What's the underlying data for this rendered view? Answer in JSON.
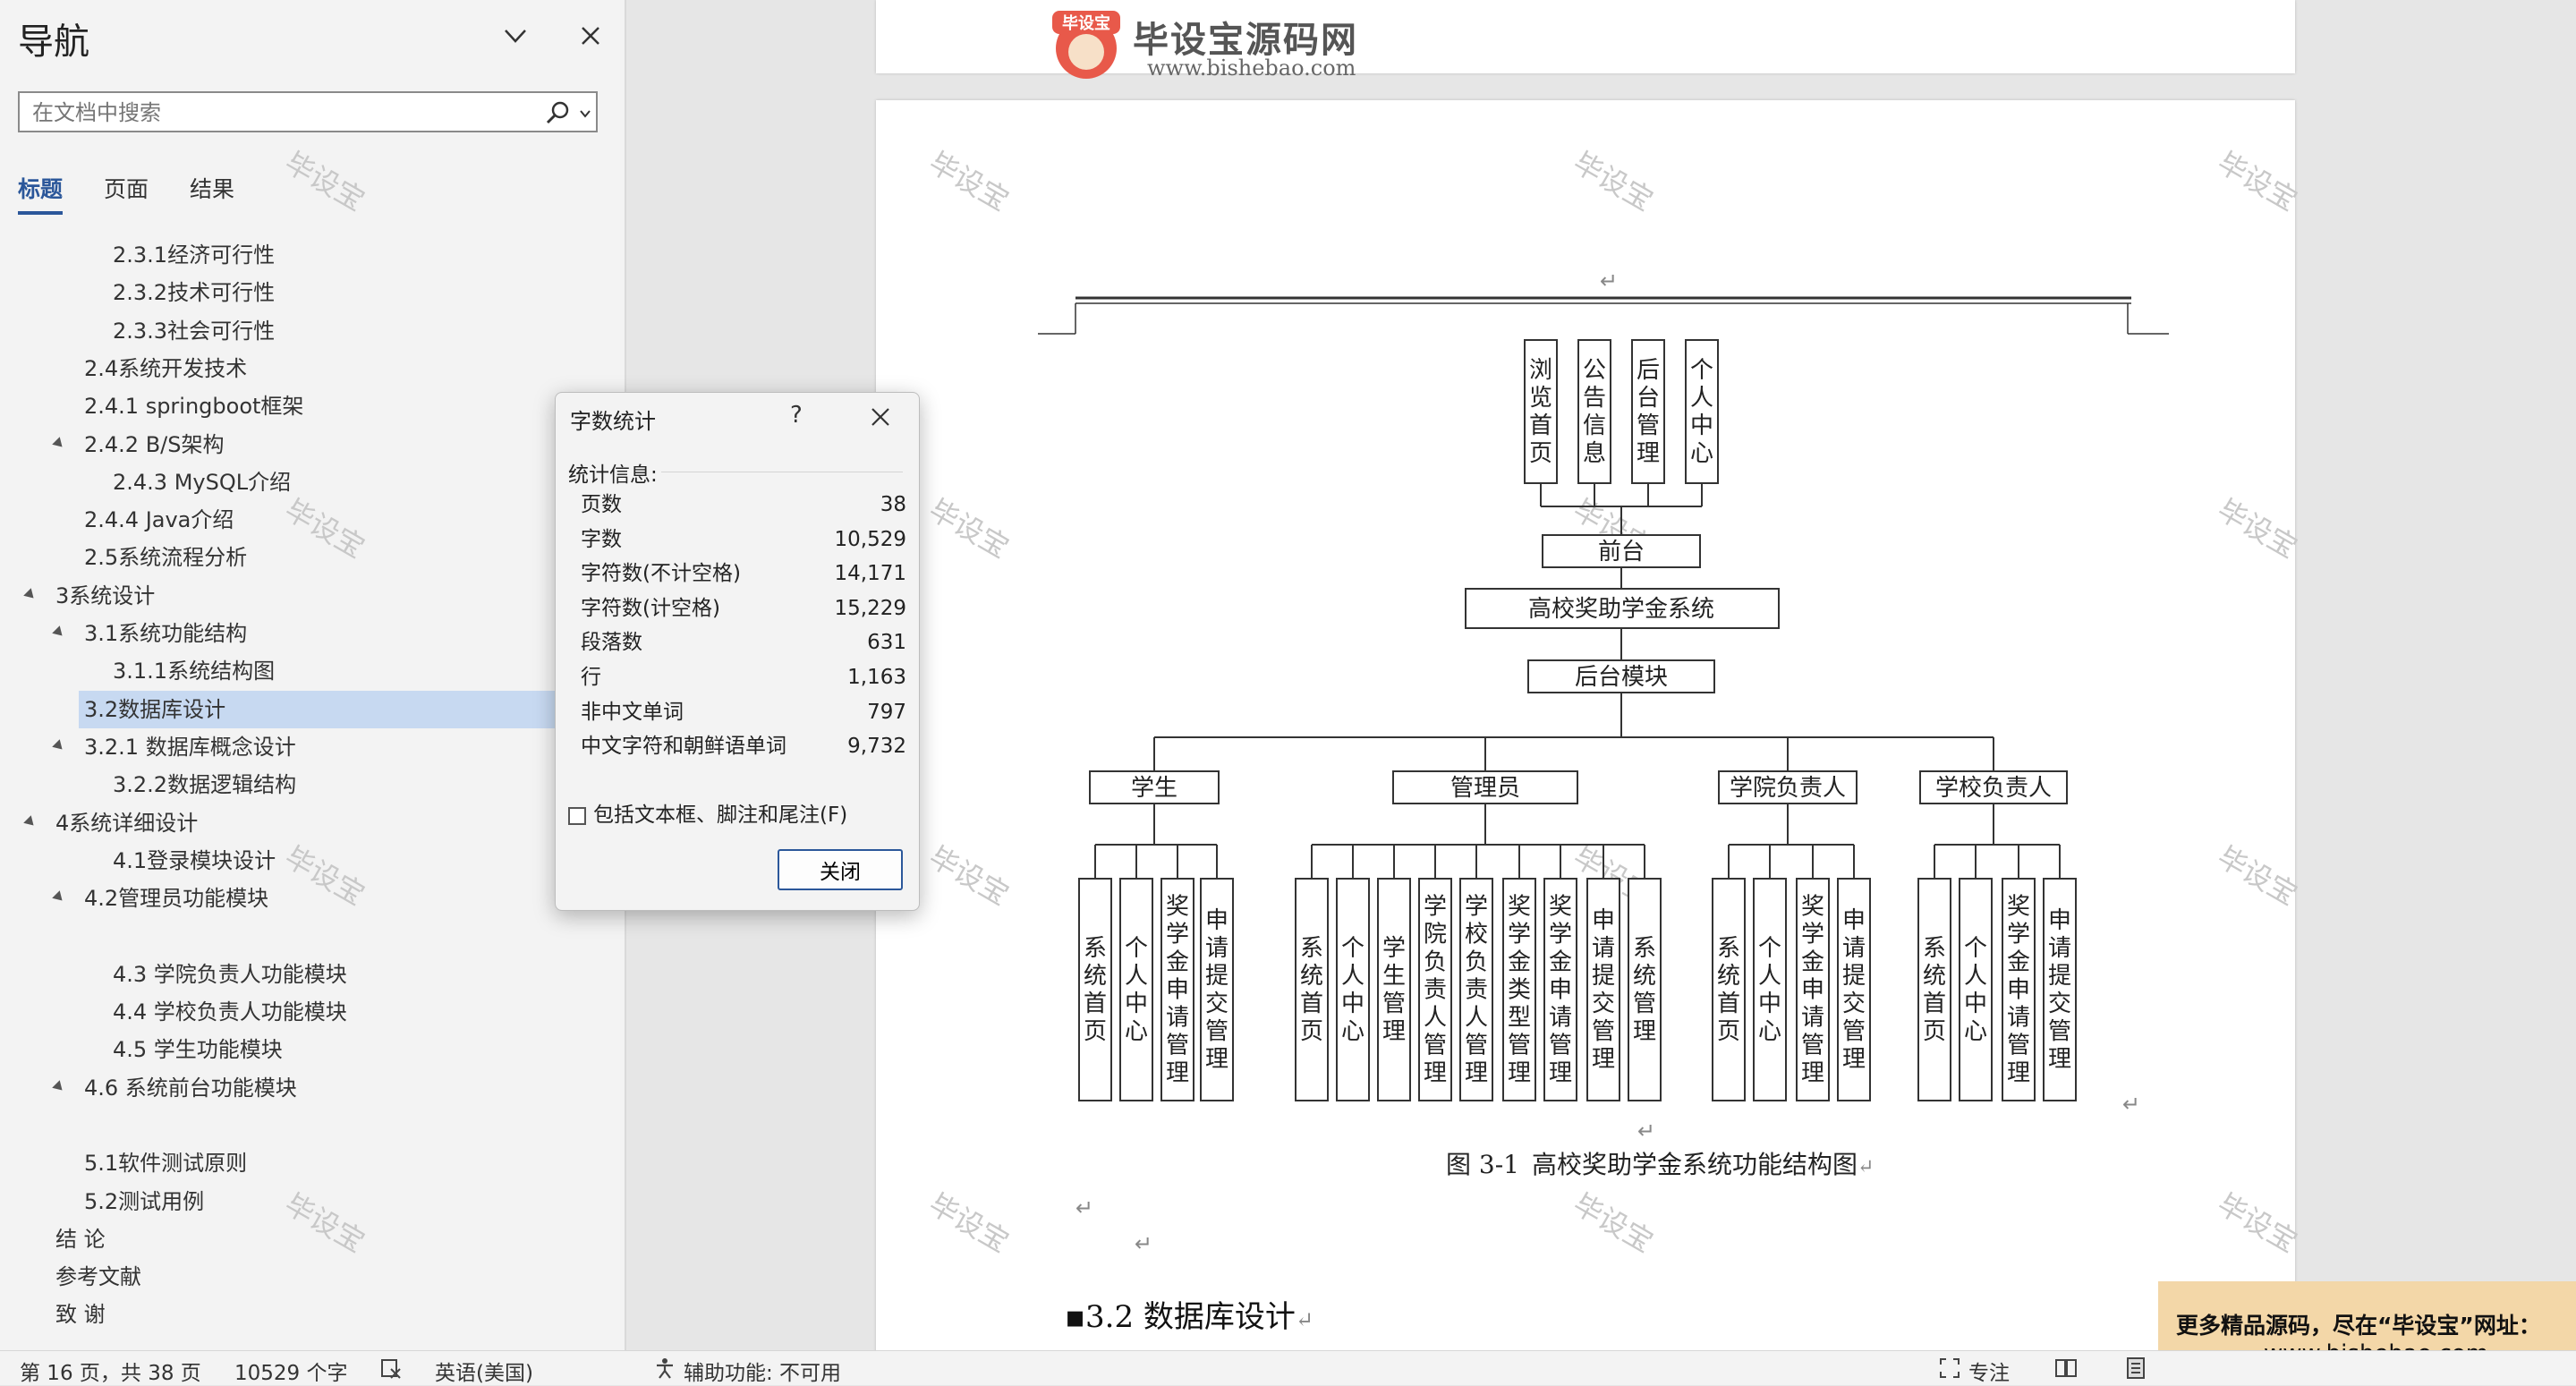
{
  "nav": {
    "title": "导航",
    "search_placeholder": "在文档中搜索",
    "tabs": [
      "标题",
      "页面",
      "结果"
    ],
    "outline": [
      {
        "label": "2.3.1经济可行性",
        "level": 3,
        "expander": false
      },
      {
        "label": "2.3.2技术可行性",
        "level": 3,
        "expander": false
      },
      {
        "label": "2.3.3社会可行性",
        "level": 3,
        "expander": false
      },
      {
        "label": "2.4系统开发技术",
        "level": 2,
        "expander": false
      },
      {
        "label": "2.4.1 springboot框架",
        "level": 2,
        "expander": false
      },
      {
        "label": "2.4.2 B/S架构",
        "level": 2,
        "expander": true
      },
      {
        "label": "2.4.3 MySQL介绍",
        "level": 3,
        "expander": false
      },
      {
        "label": "2.4.4 Java介绍",
        "level": 2,
        "expander": false
      },
      {
        "label": "2.5系统流程分析",
        "level": 2,
        "expander": false
      },
      {
        "label": "3系统设计",
        "level": 1,
        "expander": true
      },
      {
        "label": "3.1系统功能结构",
        "level": 2,
        "expander": true
      },
      {
        "label": "3.1.1系统结构图",
        "level": 3,
        "expander": false
      },
      {
        "label": "3.2数据库设计",
        "level": 2,
        "expander": false,
        "selected": true
      },
      {
        "label": "3.2.1 数据库概念设计",
        "level": 2,
        "expander": true
      },
      {
        "label": "3.2.2数据逻辑结构",
        "level": 3,
        "expander": false
      },
      {
        "label": "4系统详细设计",
        "level": 1,
        "expander": true
      },
      {
        "label": "4.1登录模块设计",
        "level": 3,
        "expander": false
      },
      {
        "label": "4.2管理员功能模块",
        "level": 2,
        "expander": true
      },
      {
        "label": "",
        "level": 3,
        "expander": false
      },
      {
        "label": "4.3 学院负责人功能模块",
        "level": 3,
        "expander": false
      },
      {
        "label": "4.4 学校负责人功能模块",
        "level": 3,
        "expander": false
      },
      {
        "label": "4.5 学生功能模块",
        "level": 3,
        "expander": false
      },
      {
        "label": "4.6 系统前台功能模块",
        "level": 2,
        "expander": true
      },
      {
        "label": "",
        "level": 2,
        "expander": false
      },
      {
        "label": "5.1软件测试原则",
        "level": 2,
        "expander": false
      },
      {
        "label": "5.2测试用例",
        "level": 2,
        "expander": false
      },
      {
        "label": "结  论",
        "level": 1,
        "expander": false
      },
      {
        "label": "参考文献",
        "level": 1,
        "expander": false
      },
      {
        "label": "致  谢",
        "level": 1,
        "expander": false
      }
    ]
  },
  "watermark": "毕设宝",
  "logo": {
    "badge": "毕设宝",
    "brand": "毕设宝源码网",
    "url": "www.bishebao.com"
  },
  "diagram": {
    "frontend_items": [
      "浏览首页",
      "公告信息",
      "后台管理",
      "个人中心"
    ],
    "frontend": "前台",
    "system": "高校奖助学金系统",
    "backend": "后台模块",
    "roles": [
      {
        "name": "学生",
        "items": [
          "系统首页",
          "个人中心",
          "奖学金申请管理",
          "申请提交管理"
        ]
      },
      {
        "name": "管理员",
        "items": [
          "系统首页",
          "个人中心",
          "学生管理",
          "学院负责人管理",
          "学校负责人管理",
          "奖学金类型管理",
          "奖学金申请管理",
          "申请提交管理",
          "系统管理"
        ]
      },
      {
        "name": "学院负责人",
        "items": [
          "系统首页",
          "个人中心",
          "奖学金申请管理",
          "申请提交管理"
        ]
      },
      {
        "name": "学校负责人",
        "items": [
          "系统首页",
          "个人中心",
          "奖学金申请管理",
          "申请提交管理"
        ]
      }
    ]
  },
  "figure_caption": {
    "number": "图 3-1",
    "text": "高校奖助学金系统功能结构图"
  },
  "section_heading": "3.2 数据库设计",
  "paragraph_mark": "↵",
  "dialog": {
    "title": "字数统计",
    "help": "?",
    "section": "统计信息:",
    "stats": [
      {
        "label": "页数",
        "value": "38"
      },
      {
        "label": "字数",
        "value": "10,529"
      },
      {
        "label": "字符数(不计空格)",
        "value": "14,171"
      },
      {
        "label": "字符数(计空格)",
        "value": "15,229"
      },
      {
        "label": "段落数",
        "value": "631"
      },
      {
        "label": "行",
        "value": "1,163"
      },
      {
        "label": "非中文单词",
        "value": "797"
      },
      {
        "label": "中文字符和朝鲜语单词",
        "value": "9,732"
      }
    ],
    "checkbox_label": "包括文本框、脚注和尾注(F)",
    "close_button": "关闭"
  },
  "ad": {
    "line1": "更多精品源码，尽在“毕设宝”网址：",
    "line2": "www.bishebao.com"
  },
  "status": {
    "page": "第 16 页，共 38 页",
    "words": "10529 个字",
    "language": "英语(美国)",
    "accessibility": "辅助功能: 不可用",
    "focus": "专注"
  }
}
